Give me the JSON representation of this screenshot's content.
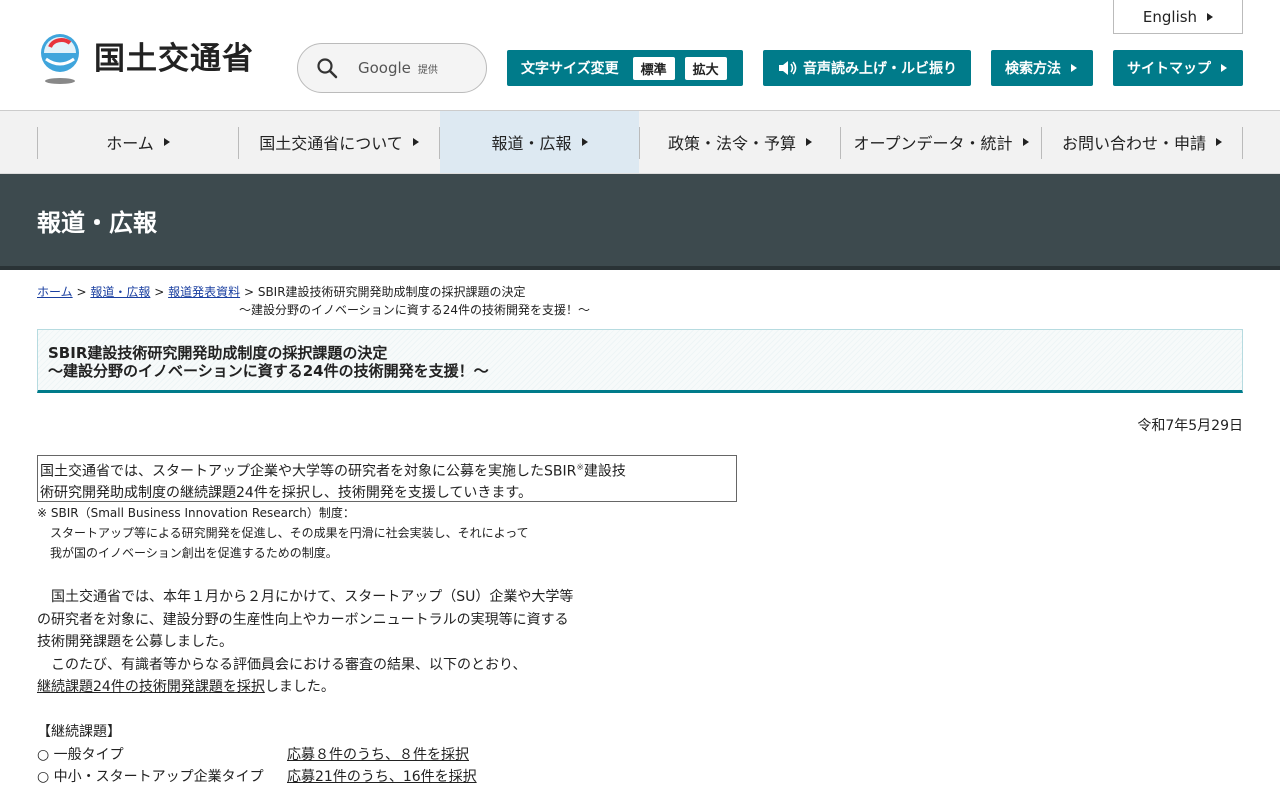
{
  "header": {
    "logo_text": "国土交通省",
    "english_label": "English",
    "search": {
      "label": "Google",
      "sub": "提供"
    },
    "font_size": {
      "label": "文字サイズ変更",
      "standard": "標準",
      "large": "拡大"
    },
    "voice_label": "音声読み上げ・ルビ振り",
    "howto_label": "検索方法",
    "sitemap_label": "サイトマップ",
    "colors": {
      "accent": "#007b8a"
    }
  },
  "nav": {
    "items": [
      {
        "label": "ホーム"
      },
      {
        "label": "国土交通省について"
      },
      {
        "label": "報道・広報"
      },
      {
        "label": "政策・法令・予算"
      },
      {
        "label": "オープンデータ・統計"
      },
      {
        "label": "お問い合わせ・申請"
      }
    ]
  },
  "band": {
    "title": "報道・広報"
  },
  "breadcrumb": {
    "home": "ホーム",
    "sep": ">",
    "l1": "報道・広報",
    "l2": "報道発表資料",
    "current_line1": "SBIR建設技術研究開発助成制度の採択課題の決定",
    "current_line2": "～建設分野のイノベーションに資する24件の技術開発を支援！～"
  },
  "article": {
    "title_line1": "SBIR建設技術研究開発助成制度の採択課題の決定",
    "title_line2": "～建設分野のイノベーションに資する24件の技術開発を支援！～",
    "date": "令和7年5月29日",
    "summary_a": "国土交通省では、スタートアップ企業や大学等の研究者を対象に公募を実施したSBIR",
    "summary_mark": "※",
    "summary_b": "建設技",
    "summary_line2": "術研究開発助成制度の継続課題24件を採択し、技術開発を支援していきます。",
    "note_line1": "※ SBIR（Small Business Innovation Research）制度：",
    "note_line2": "スタートアップ等による研究開発を促進し、その成果を円滑に社会実装し、それによって",
    "note_line3": "我が国のイノベーション創出を促進するための制度。",
    "para_line1": "　国土交通省では、本年１月から２月にかけて、スタートアップ（SU）企業や大学等",
    "para_line2": "の研究者を対象に、建設分野の生産性向上やカーボンニュートラルの実現等に資する",
    "para_line3": "技術開発課題を公募しました。",
    "para_line4": "　このたび、有識者等からなる評価員会における審査の結果、以下のとおり、",
    "para_line5_u": "継続課題24件の技術開発課題を採択",
    "para_line5_rest": "しました。",
    "section_title": "【継続課題】",
    "rows": [
      {
        "label": "○ 一般タイプ",
        "value": "応募８件のうち、８件を採択"
      },
      {
        "label": "○ 中小・スタートアップ企業タイプ",
        "value": "応募21件のうち、16件を採択"
      }
    ]
  }
}
